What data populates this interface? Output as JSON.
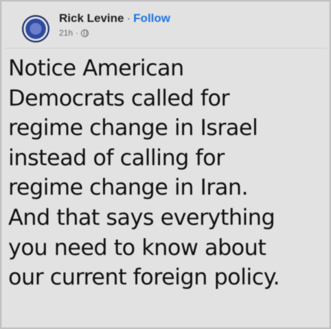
{
  "post": {
    "author": "Rick Levine",
    "separator": "·",
    "follow_label": "Follow",
    "time": "21h",
    "meta_separator": "·",
    "audience_icon": "globe-icon",
    "text_lines": [
      "Notice American",
      "Democrats called for",
      "regime change in Israel",
      "instead of calling for",
      "regime change in Iran.",
      "And that says everything",
      "you need to know about",
      "our current foreign policy."
    ]
  },
  "colors": {
    "background": "#e2e2e2",
    "link": "#1b74e4",
    "text": "#111111",
    "muted": "#65676b"
  }
}
